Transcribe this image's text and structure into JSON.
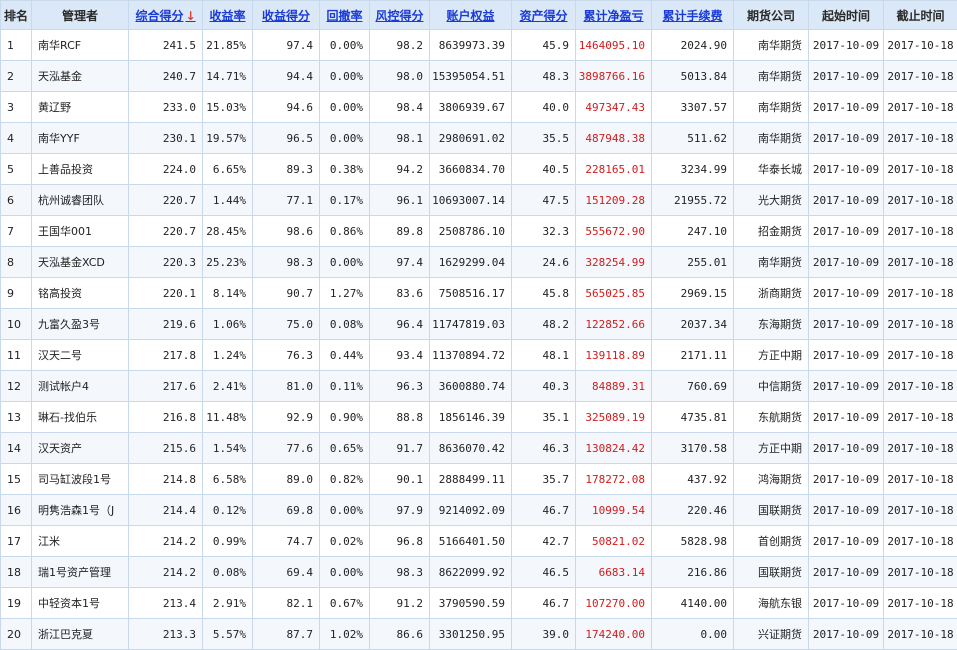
{
  "headers": {
    "rank": "排名",
    "manager": "管理者",
    "composite": "综合得分",
    "return_rate": "收益率",
    "return_score": "收益得分",
    "drawdown": "回撤率",
    "risk_score": "风控得分",
    "equity": "账户权益",
    "asset_score": "资产得分",
    "net_profit": "累计净盈亏",
    "fees": "累计手续费",
    "company": "期货公司",
    "start": "起始时间",
    "end": "截止时间",
    "sort_arrow": "↓"
  },
  "colors": {
    "header_bg": "#dbe8f7",
    "link": "#1a3bd8",
    "profit": "#d21b1b",
    "sort_arrow": "#e53a2e"
  },
  "rows": [
    {
      "rank": "1",
      "manager": "南华RCF",
      "composite": "241.5",
      "return_rate": "21.85%",
      "return_score": "97.4",
      "drawdown": "0.00%",
      "risk_score": "98.2",
      "equity": "8639973.39",
      "asset_score": "45.9",
      "net_profit": "1464095.10",
      "fees": "2024.90",
      "company": "南华期货",
      "start": "2017-10-09",
      "end": "2017-10-18"
    },
    {
      "rank": "2",
      "manager": "天泓基金",
      "composite": "240.7",
      "return_rate": "14.71%",
      "return_score": "94.4",
      "drawdown": "0.00%",
      "risk_score": "98.0",
      "equity": "15395054.51",
      "asset_score": "48.3",
      "net_profit": "3898766.16",
      "fees": "5013.84",
      "company": "南华期货",
      "start": "2017-10-09",
      "end": "2017-10-18"
    },
    {
      "rank": "3",
      "manager": "黄辽野",
      "composite": "233.0",
      "return_rate": "15.03%",
      "return_score": "94.6",
      "drawdown": "0.00%",
      "risk_score": "98.4",
      "equity": "3806939.67",
      "asset_score": "40.0",
      "net_profit": "497347.43",
      "fees": "3307.57",
      "company": "南华期货",
      "start": "2017-10-09",
      "end": "2017-10-18"
    },
    {
      "rank": "4",
      "manager": "南华YYF",
      "composite": "230.1",
      "return_rate": "19.57%",
      "return_score": "96.5",
      "drawdown": "0.00%",
      "risk_score": "98.1",
      "equity": "2980691.02",
      "asset_score": "35.5",
      "net_profit": "487948.38",
      "fees": "511.62",
      "company": "南华期货",
      "start": "2017-10-09",
      "end": "2017-10-18"
    },
    {
      "rank": "5",
      "manager": "上善品投资",
      "composite": "224.0",
      "return_rate": "6.65%",
      "return_score": "89.3",
      "drawdown": "0.38%",
      "risk_score": "94.2",
      "equity": "3660834.70",
      "asset_score": "40.5",
      "net_profit": "228165.01",
      "fees": "3234.99",
      "company": "华泰长城",
      "start": "2017-10-09",
      "end": "2017-10-18"
    },
    {
      "rank": "6",
      "manager": "杭州诚睿团队",
      "composite": "220.7",
      "return_rate": "1.44%",
      "return_score": "77.1",
      "drawdown": "0.17%",
      "risk_score": "96.1",
      "equity": "10693007.14",
      "asset_score": "47.5",
      "net_profit": "151209.28",
      "fees": "21955.72",
      "company": "光大期货",
      "start": "2017-10-09",
      "end": "2017-10-18"
    },
    {
      "rank": "7",
      "manager": "王国华001",
      "composite": "220.7",
      "return_rate": "28.45%",
      "return_score": "98.6",
      "drawdown": "0.86%",
      "risk_score": "89.8",
      "equity": "2508786.10",
      "asset_score": "32.3",
      "net_profit": "555672.90",
      "fees": "247.10",
      "company": "招金期货",
      "start": "2017-10-09",
      "end": "2017-10-18"
    },
    {
      "rank": "8",
      "manager": "天泓基金XCD",
      "composite": "220.3",
      "return_rate": "25.23%",
      "return_score": "98.3",
      "drawdown": "0.00%",
      "risk_score": "97.4",
      "equity": "1629299.04",
      "asset_score": "24.6",
      "net_profit": "328254.99",
      "fees": "255.01",
      "company": "南华期货",
      "start": "2017-10-09",
      "end": "2017-10-18"
    },
    {
      "rank": "9",
      "manager": "铭高投资",
      "composite": "220.1",
      "return_rate": "8.14%",
      "return_score": "90.7",
      "drawdown": "1.27%",
      "risk_score": "83.6",
      "equity": "7508516.17",
      "asset_score": "45.8",
      "net_profit": "565025.85",
      "fees": "2969.15",
      "company": "浙商期货",
      "start": "2017-10-09",
      "end": "2017-10-18"
    },
    {
      "rank": "10",
      "manager": "九富久盈3号",
      "composite": "219.6",
      "return_rate": "1.06%",
      "return_score": "75.0",
      "drawdown": "0.08%",
      "risk_score": "96.4",
      "equity": "11747819.03",
      "asset_score": "48.2",
      "net_profit": "122852.66",
      "fees": "2037.34",
      "company": "东海期货",
      "start": "2017-10-09",
      "end": "2017-10-18"
    },
    {
      "rank": "11",
      "manager": "汉天二号",
      "composite": "217.8",
      "return_rate": "1.24%",
      "return_score": "76.3",
      "drawdown": "0.44%",
      "risk_score": "93.4",
      "equity": "11370894.72",
      "asset_score": "48.1",
      "net_profit": "139118.89",
      "fees": "2171.11",
      "company": "方正中期",
      "start": "2017-10-09",
      "end": "2017-10-18"
    },
    {
      "rank": "12",
      "manager": "测试帐户4",
      "composite": "217.6",
      "return_rate": "2.41%",
      "return_score": "81.0",
      "drawdown": "0.11%",
      "risk_score": "96.3",
      "equity": "3600880.74",
      "asset_score": "40.3",
      "net_profit": "84889.31",
      "fees": "760.69",
      "company": "中信期货",
      "start": "2017-10-09",
      "end": "2017-10-18"
    },
    {
      "rank": "13",
      "manager": "琳石-找伯乐",
      "composite": "216.8",
      "return_rate": "11.48%",
      "return_score": "92.9",
      "drawdown": "0.90%",
      "risk_score": "88.8",
      "equity": "1856146.39",
      "asset_score": "35.1",
      "net_profit": "325089.19",
      "fees": "4735.81",
      "company": "东航期货",
      "start": "2017-10-09",
      "end": "2017-10-18"
    },
    {
      "rank": "14",
      "manager": "汉天资产",
      "composite": "215.6",
      "return_rate": "1.54%",
      "return_score": "77.6",
      "drawdown": "0.65%",
      "risk_score": "91.7",
      "equity": "8636070.42",
      "asset_score": "46.3",
      "net_profit": "130824.42",
      "fees": "3170.58",
      "company": "方正中期",
      "start": "2017-10-09",
      "end": "2017-10-18"
    },
    {
      "rank": "15",
      "manager": "司马缸波段1号",
      "composite": "214.8",
      "return_rate": "6.58%",
      "return_score": "89.0",
      "drawdown": "0.82%",
      "risk_score": "90.1",
      "equity": "2888499.11",
      "asset_score": "35.7",
      "net_profit": "178272.08",
      "fees": "437.92",
      "company": "鸿海期货",
      "start": "2017-10-09",
      "end": "2017-10-18"
    },
    {
      "rank": "16",
      "manager": "明隽浩森1号（J",
      "composite": "214.4",
      "return_rate": "0.12%",
      "return_score": "69.8",
      "drawdown": "0.00%",
      "risk_score": "97.9",
      "equity": "9214092.09",
      "asset_score": "46.7",
      "net_profit": "10999.54",
      "fees": "220.46",
      "company": "国联期货",
      "start": "2017-10-09",
      "end": "2017-10-18"
    },
    {
      "rank": "17",
      "manager": "江米",
      "composite": "214.2",
      "return_rate": "0.99%",
      "return_score": "74.7",
      "drawdown": "0.02%",
      "risk_score": "96.8",
      "equity": "5166401.50",
      "asset_score": "42.7",
      "net_profit": "50821.02",
      "fees": "5828.98",
      "company": "首创期货",
      "start": "2017-10-09",
      "end": "2017-10-18"
    },
    {
      "rank": "18",
      "manager": "瑞1号资产管理",
      "composite": "214.2",
      "return_rate": "0.08%",
      "return_score": "69.4",
      "drawdown": "0.00%",
      "risk_score": "98.3",
      "equity": "8622099.92",
      "asset_score": "46.5",
      "net_profit": "6683.14",
      "fees": "216.86",
      "company": "国联期货",
      "start": "2017-10-09",
      "end": "2017-10-18"
    },
    {
      "rank": "19",
      "manager": "中轻资本1号",
      "composite": "213.4",
      "return_rate": "2.91%",
      "return_score": "82.1",
      "drawdown": "0.67%",
      "risk_score": "91.2",
      "equity": "3790590.59",
      "asset_score": "46.7",
      "net_profit": "107270.00",
      "fees": "4140.00",
      "company": "海航东银",
      "start": "2017-10-09",
      "end": "2017-10-18"
    },
    {
      "rank": "20",
      "manager": "浙江巴克夏",
      "composite": "213.3",
      "return_rate": "5.57%",
      "return_score": "87.7",
      "drawdown": "1.02%",
      "risk_score": "86.6",
      "equity": "3301250.95",
      "asset_score": "39.0",
      "net_profit": "174240.00",
      "fees": "0.00",
      "company": "兴证期货",
      "start": "2017-10-09",
      "end": "2017-10-18"
    }
  ]
}
